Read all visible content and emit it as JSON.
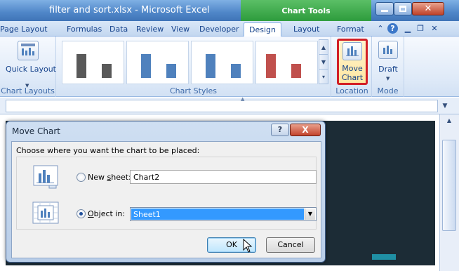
{
  "window": {
    "title": "filter and sort.xlsx - Microsoft Excel",
    "contextual_group": "Chart Tools"
  },
  "tabs": [
    {
      "label": "Page Layout"
    },
    {
      "label": "Formulas"
    },
    {
      "label": "Data"
    },
    {
      "label": "Review"
    },
    {
      "label": "View"
    },
    {
      "label": "Developer"
    },
    {
      "label": "Design",
      "active": true
    },
    {
      "label": "Layout"
    },
    {
      "label": "Format"
    }
  ],
  "ribbon": {
    "chart_layouts": {
      "group_label": "Chart Layouts",
      "quick_layout_label": "Quick Layout"
    },
    "chart_styles": {
      "group_label": "Chart Styles",
      "thumbnails": [
        {
          "bar_color": "#595959"
        },
        {
          "bar_color": "#4f81bd"
        },
        {
          "bar_color": "#4f81bd"
        },
        {
          "bar_color": "#c0504d"
        }
      ]
    },
    "location": {
      "group_label": "Location",
      "move_chart_label": "Move Chart"
    },
    "mode": {
      "group_label": "Mode",
      "draft_label": "Draft"
    }
  },
  "dialog": {
    "title": "Move Chart",
    "help_glyph": "?",
    "close_glyph": "X",
    "prompt": "Choose where you want the chart to be placed:",
    "new_sheet": {
      "label_before": "New ",
      "label_underlined": "s",
      "label_after": "heet:",
      "value": "Chart2",
      "selected": false
    },
    "object_in": {
      "label_underlined": "O",
      "label_after": "bject in:",
      "value": "Sheet1",
      "selected": true
    },
    "ok_label": "OK",
    "cancel_label": "Cancel"
  },
  "colors": {
    "highlight_border": "#d21f26",
    "selection": "#3399ff",
    "chart_background": "#1c2c36",
    "chart_accent": "#1f8fa4"
  }
}
